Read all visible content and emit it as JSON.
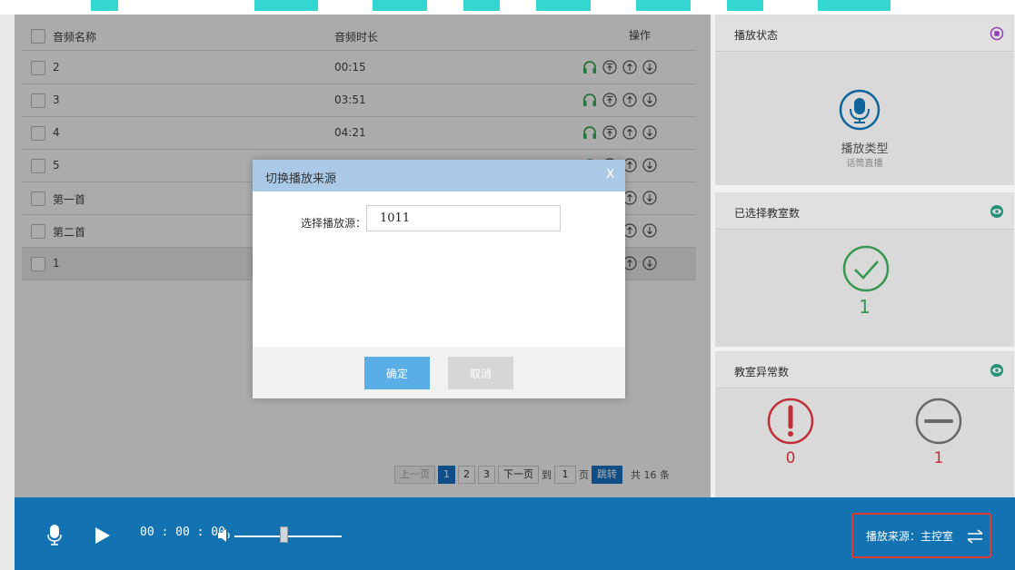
{
  "table": {
    "headers": {
      "name": "音频名称",
      "duration": "音频时长",
      "actions": "操作"
    },
    "rows": [
      {
        "name": "2",
        "duration": "00:15"
      },
      {
        "name": "3",
        "duration": "03:51"
      },
      {
        "name": "4",
        "duration": "04:21"
      },
      {
        "name": "5",
        "duration": ""
      },
      {
        "name": "第一首",
        "duration": ""
      },
      {
        "name": "第二首",
        "duration": ""
      },
      {
        "name": "1",
        "duration": ""
      }
    ]
  },
  "pagination": {
    "prev": "上一页",
    "pages": [
      "1",
      "2",
      "3"
    ],
    "next": "下一页",
    "to": "到",
    "page_input": "1",
    "page_unit": "页",
    "go": "跳转",
    "total": "共 16 条"
  },
  "status_panel": {
    "title": "播放状态",
    "type_label": "播放类型",
    "type_value": "话筒直播"
  },
  "selected_panel": {
    "title": "已选择教室数",
    "count": "1"
  },
  "abnormal_panel": {
    "title": "教室异常数",
    "error_count": "0",
    "offline_count": "1"
  },
  "player": {
    "time": "00 : 00 : 00",
    "volume_fraction": 0.46,
    "source_label": "播放来源：主控室"
  },
  "modal": {
    "title": "切换播放来源",
    "close": "X",
    "field_label": "选择播放源：",
    "field_value": "1011",
    "ok": "确定",
    "cancel": "取消"
  },
  "colors": {
    "accent_blue": "#1272b2",
    "modal_header": "#a9c9e6",
    "ok_green": "#3dae5b",
    "error_red": "#d9363e",
    "highlight_red": "#e23a2f"
  }
}
